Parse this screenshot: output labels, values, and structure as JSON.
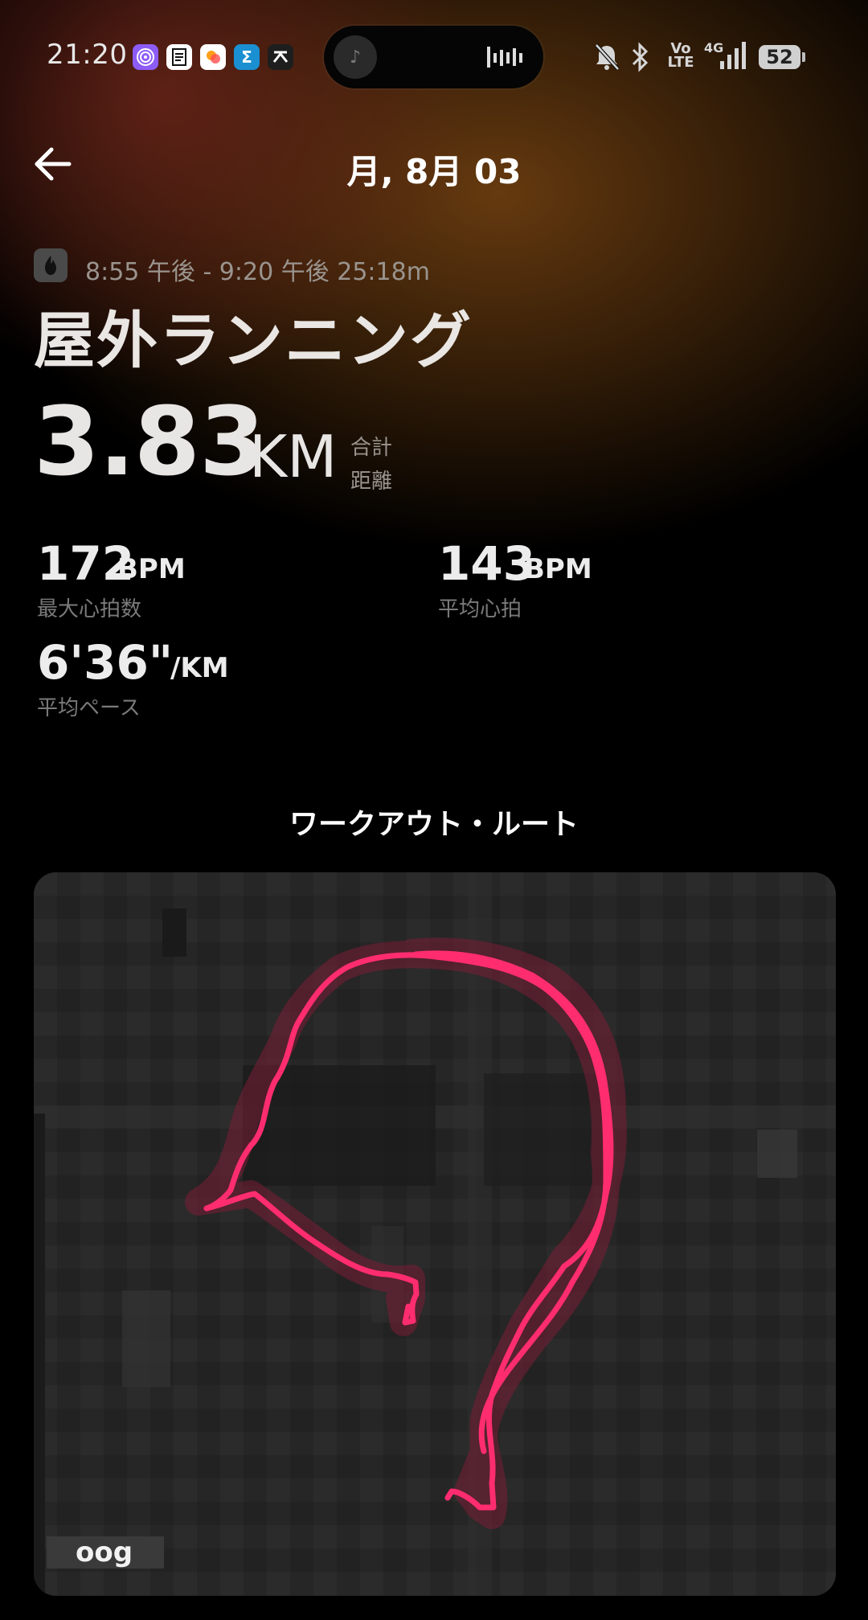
{
  "status_bar": {
    "time": "21:20",
    "app_icons": [
      "fingerprint-app-icon",
      "notes-app-icon",
      "photos-app-icon",
      "sigma-app-icon",
      "arrow-app-icon"
    ],
    "system_icons": [
      "mute-bell-icon",
      "bluetooth-icon",
      "volte-icon",
      "4g-signal-icon"
    ],
    "volte_label": "Vo\nLTE",
    "network_label": "4G",
    "battery": "52"
  },
  "header": {
    "title": "月, 8月 03",
    "back_icon": "arrow-left-icon"
  },
  "workout": {
    "badge_icon": "flame-icon",
    "time_range": "8:55 午後 - 9:20 午後  25:18m",
    "name": "屋外ランニング",
    "distance_value": "3.83",
    "distance_unit": "KM",
    "distance_label_line1": "合計",
    "distance_label_line2": "距離",
    "stats": {
      "max_hr": {
        "value": "172",
        "unit": "BPM",
        "label": "最大心拍数"
      },
      "avg_hr": {
        "value": "143",
        "unit": "BPM",
        "label": "平均心拍"
      },
      "avg_pace": {
        "value": "6'36\"",
        "unit": "/KM",
        "label": "平均ペース"
      }
    }
  },
  "route": {
    "title": "ワークアウト・ルート",
    "map_credit": "oog",
    "route_color": "#ff2d6f"
  },
  "colors": {
    "accent_route": "#ff2d6f",
    "secondary_text": "#9a948e",
    "label_text": "#7a7a7a"
  }
}
